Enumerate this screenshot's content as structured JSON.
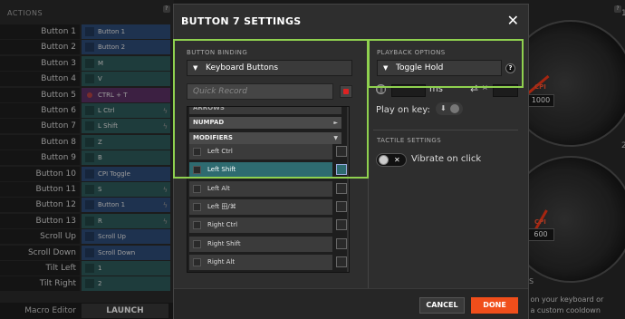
{
  "actions": {
    "header": "ACTIONS",
    "help": "?",
    "rows": [
      {
        "label": "Button 1",
        "value": "Button 1",
        "color": "blue",
        "bolt": false,
        "rec": false
      },
      {
        "label": "Button 2",
        "value": "Button 2",
        "color": "blue",
        "bolt": false,
        "rec": false
      },
      {
        "label": "Button 3",
        "value": "M",
        "color": "teal",
        "bolt": false,
        "rec": false
      },
      {
        "label": "Button 4",
        "value": "V",
        "color": "teal",
        "bolt": false,
        "rec": false
      },
      {
        "label": "Button 5",
        "value": "CTRL + T",
        "color": "purple",
        "bolt": false,
        "rec": true
      },
      {
        "label": "Button 6",
        "value": "L Ctrl",
        "color": "teal",
        "bolt": true,
        "rec": false
      },
      {
        "label": "Button 7",
        "value": "L Shift",
        "color": "teal",
        "bolt": true,
        "rec": false
      },
      {
        "label": "Button 8",
        "value": "Z",
        "color": "teal",
        "bolt": false,
        "rec": false
      },
      {
        "label": "Button 9",
        "value": "B",
        "color": "teal",
        "bolt": false,
        "rec": false
      },
      {
        "label": "Button 10",
        "value": "CPI Toggle",
        "color": "blue",
        "bolt": false,
        "rec": false
      },
      {
        "label": "Button 11",
        "value": "S",
        "color": "teal",
        "bolt": true,
        "rec": false
      },
      {
        "label": "Button 12",
        "value": "Button 1",
        "color": "blue",
        "bolt": true,
        "rec": false
      },
      {
        "label": "Button 13",
        "value": "R",
        "color": "teal",
        "bolt": true,
        "rec": false
      },
      {
        "label": "Scroll Up",
        "value": "Scroll Up",
        "color": "blue",
        "bolt": false,
        "rec": false
      },
      {
        "label": "Scroll Down",
        "value": "Scroll Down",
        "color": "blue",
        "bolt": false,
        "rec": false
      },
      {
        "label": "Tilt Left",
        "value": "1",
        "color": "teal",
        "bolt": false,
        "rec": false
      },
      {
        "label": "Tilt Right",
        "value": "2",
        "color": "teal",
        "bolt": false,
        "rec": false
      }
    ],
    "macro_label": "Macro Editor",
    "launch_label": "LAUNCH"
  },
  "right": {
    "gauge1_title": "1)",
    "gauge2_title": "2)",
    "cpi_label": "CPI",
    "cpi1": "1000",
    "cpi2": "600",
    "help": "?",
    "ns_label": "NS",
    "bottom_line1": "e on your keyboard or",
    "bottom_line2": "e a custom cooldown",
    "bottom_line3": "…"
  },
  "modal": {
    "title": "BUTTON 7 SETTINGS",
    "close": "✕",
    "binding": {
      "section_title": "BUTTON BINDING",
      "type_value": "Keyboard Buttons",
      "quick_record_placeholder": "Quick Record",
      "partial_top": "ARROWS",
      "categories": [
        {
          "label": "NUMPAD",
          "arrow": "►"
        },
        {
          "label": "MODIFIERS",
          "arrow": "▼"
        }
      ],
      "keys": [
        {
          "label": "Left Ctrl",
          "selected": false
        },
        {
          "label": "Left Shift",
          "selected": true
        },
        {
          "label": "Left Alt",
          "selected": false
        },
        {
          "label": "Left 田/⌘",
          "selected": false
        },
        {
          "label": "Right Ctrl",
          "selected": false
        },
        {
          "label": "Right Shift",
          "selected": false
        },
        {
          "label": "Right Alt",
          "selected": false
        },
        {
          "label": "Right 田/⌘",
          "selected": false
        }
      ]
    },
    "playback": {
      "section_title": "PLAYBACK OPTIONS",
      "mode_value": "Toggle Hold",
      "help": "?",
      "ms_label": "ms",
      "x_label": "×",
      "play_on_key": "Play on key:"
    },
    "tactile": {
      "section_title": "TACTILE SETTINGS",
      "vibrate_label": "Vibrate on click"
    },
    "cancel_label": "CANCEL",
    "done_label": "DONE"
  },
  "colors": {
    "accent_green": "#8fd14f",
    "done_orange": "#f04e1b",
    "selected_teal": "#2e6b70"
  }
}
